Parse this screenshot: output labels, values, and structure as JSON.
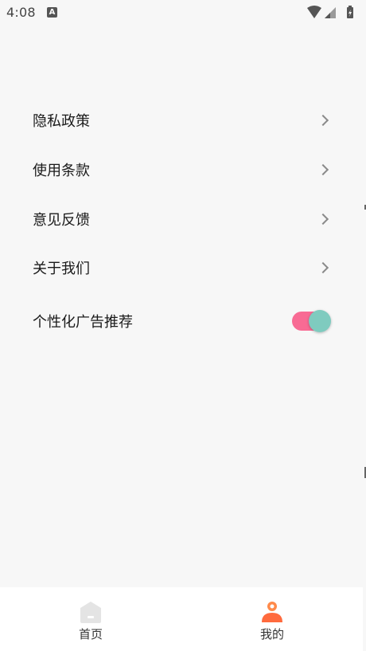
{
  "status_bar": {
    "time": "4:08",
    "indicator": "A",
    "icons": [
      "wifi-icon",
      "signal-icon",
      "battery-charging-icon"
    ]
  },
  "settings": {
    "items": [
      {
        "label": "隐私政策",
        "control": "chevron"
      },
      {
        "label": "使用条款",
        "control": "chevron"
      },
      {
        "label": "意见反馈",
        "control": "chevron"
      },
      {
        "label": "关于我们",
        "control": "chevron"
      }
    ],
    "ad_toggle": {
      "label": "个性化广告推荐",
      "on": true
    }
  },
  "tab_bar": {
    "tabs": [
      {
        "label": "首页",
        "icon": "home-icon",
        "active": false
      },
      {
        "label": "我的",
        "icon": "profile-icon",
        "active": true
      }
    ]
  },
  "colors": {
    "background": "#f7f7f7",
    "toggle_track": "#f86b94",
    "toggle_knob": "#7fcbbf",
    "active_tab_icon": "#ff6a3d",
    "inactive_tab_icon": "#e4e4e4"
  }
}
